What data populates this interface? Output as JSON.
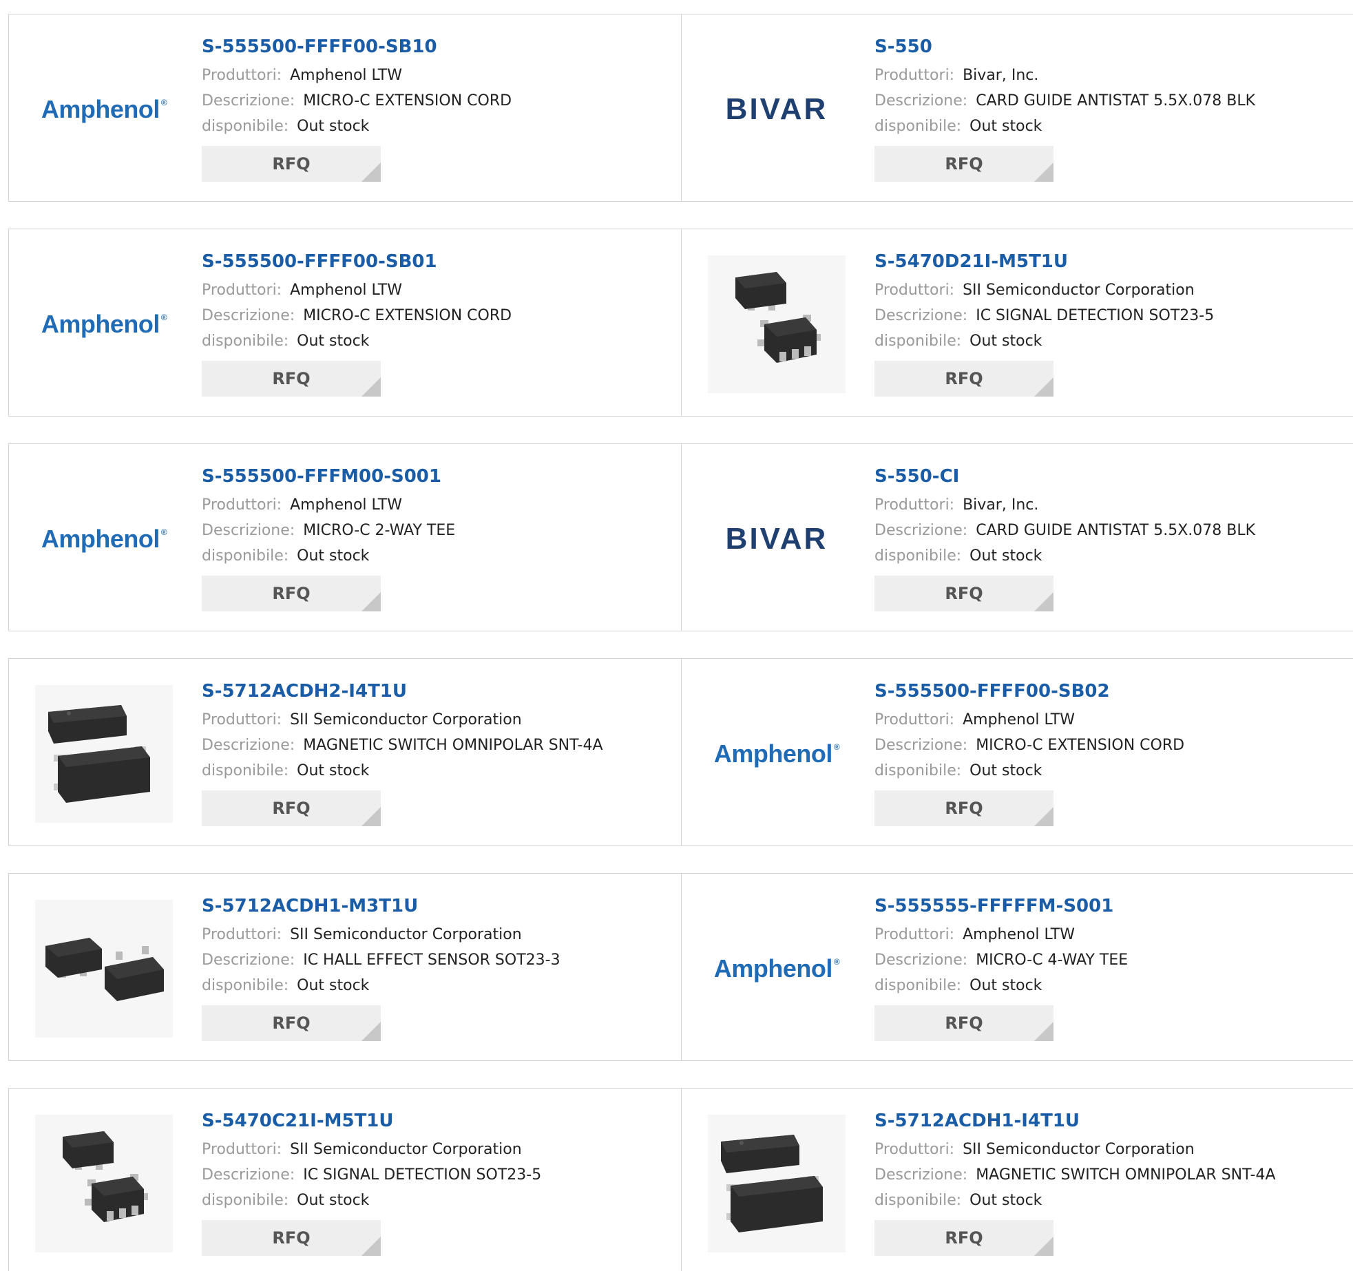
{
  "labels": {
    "manufacturer": "Produttori:",
    "description": "Descrizione:",
    "availability": "disponibile:",
    "rfq": "RFQ"
  },
  "brand_logos": {
    "amphenol": "Amphenol",
    "bivar": "BIVAR"
  },
  "colors": {
    "link": "#1a5da6",
    "label_gray": "#9a9a9a",
    "border": "#d4d4d4",
    "rfq_bg": "#eeeeee",
    "amphenol_blue": "#1f6bb6",
    "bivar_navy": "#1f3f70"
  },
  "products": [
    {
      "part": "S-555500-FFFF00-SB10",
      "manufacturer": "Amphenol LTW",
      "description": "MICRO-C EXTENSION CORD",
      "availability": "Out stock",
      "image": "amphenol-logo"
    },
    {
      "part": "S-550",
      "manufacturer": "Bivar, Inc.",
      "description": "CARD GUIDE ANTISTAT 5.5X.078 BLK",
      "availability": "Out stock",
      "image": "bivar-logo"
    },
    {
      "part": "S-555500-FFFF00-SB01",
      "manufacturer": "Amphenol LTW",
      "description": "MICRO-C EXTENSION CORD",
      "availability": "Out stock",
      "image": "amphenol-logo"
    },
    {
      "part": "S-5470D21I-M5T1U",
      "manufacturer": "SII Semiconductor Corporation",
      "description": "IC SIGNAL DETECTION SOT23-5",
      "availability": "Out stock",
      "image": "sot23-5-chip"
    },
    {
      "part": "S-555500-FFFM00-S001",
      "manufacturer": "Amphenol LTW",
      "description": "MICRO-C 2-WAY TEE",
      "availability": "Out stock",
      "image": "amphenol-logo"
    },
    {
      "part": "S-550-CI",
      "manufacturer": "Bivar, Inc.",
      "description": "CARD GUIDE ANTISTAT 5.5X.078 BLK",
      "availability": "Out stock",
      "image": "bivar-logo"
    },
    {
      "part": "S-5712ACDH2-I4T1U",
      "manufacturer": "SII Semiconductor Corporation",
      "description": "MAGNETIC SWITCH OMNIPOLAR SNT-4A",
      "availability": "Out stock",
      "image": "snt-4a-chip"
    },
    {
      "part": "S-555500-FFFF00-SB02",
      "manufacturer": "Amphenol LTW",
      "description": "MICRO-C EXTENSION CORD",
      "availability": "Out stock",
      "image": "amphenol-logo"
    },
    {
      "part": "S-5712ACDH1-M3T1U",
      "manufacturer": "SII Semiconductor Corporation",
      "description": "IC HALL EFFECT SENSOR SOT23-3",
      "availability": "Out stock",
      "image": "sot23-3-chip"
    },
    {
      "part": "S-555555-FFFFFM-S001",
      "manufacturer": "Amphenol LTW",
      "description": "MICRO-C 4-WAY TEE",
      "availability": "Out stock",
      "image": "amphenol-logo"
    },
    {
      "part": "S-5470C21I-M5T1U",
      "manufacturer": "SII Semiconductor Corporation",
      "description": "IC SIGNAL DETECTION SOT23-5",
      "availability": "Out stock",
      "image": "sot23-5-chip"
    },
    {
      "part": "S-5712ACDH1-I4T1U",
      "manufacturer": "SII Semiconductor Corporation",
      "description": "MAGNETIC SWITCH OMNIPOLAR SNT-4A",
      "availability": "Out stock",
      "image": "snt-4a-chip"
    }
  ]
}
